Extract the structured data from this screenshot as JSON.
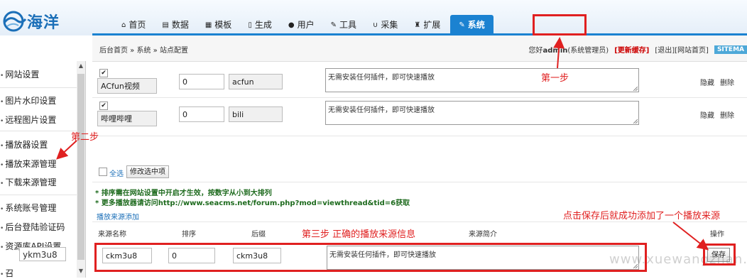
{
  "logo": {
    "text": "海洋"
  },
  "nav": [
    {
      "label": "首页",
      "icon": "home-icon",
      "glyph": "⌂"
    },
    {
      "label": "数据",
      "icon": "book-icon",
      "glyph": "▤"
    },
    {
      "label": "模板",
      "icon": "template-icon",
      "glyph": "▦"
    },
    {
      "label": "生成",
      "icon": "file-icon",
      "glyph": "▯"
    },
    {
      "label": "用户",
      "icon": "user-icon",
      "glyph": "●"
    },
    {
      "label": "工具",
      "icon": "wrench-icon",
      "glyph": "✎"
    },
    {
      "label": "采集",
      "icon": "magnet-icon",
      "glyph": "∪"
    },
    {
      "label": "扩展",
      "icon": "puzzle-icon",
      "glyph": "♜"
    },
    {
      "label": "系统",
      "icon": "edit-icon",
      "glyph": "✎"
    }
  ],
  "crumb": "后台首页 » 系统 » 站点配置",
  "user": {
    "greeting": "您好",
    "name": "admin",
    "role": "(系统管理员)",
    "refresh": "[更新缓存]",
    "logout": "[退出]",
    "home": "[网站首页]",
    "sitemap": "SITEMA"
  },
  "sidebar": [
    "网站设置",
    "图片水印设置",
    "远程图片设置",
    "播放器设置",
    "播放来源管理",
    "下载来源管理",
    "系统账号管理",
    "后台登陆验证码",
    "资源库API设置"
  ],
  "sidebar_input": "ykm3u8",
  "sidebar_last": "召",
  "rows": [
    {
      "name": "ACfun视频",
      "sort": "0",
      "suffix": "acfun",
      "desc": "无需安装任何插件，即可快速播放",
      "hide": "隐藏",
      "del": "删除",
      "checked": "✔"
    },
    {
      "name": "哔哩哔哩",
      "sort": "0",
      "suffix": "bili",
      "desc": "无需安装任何插件，即可快速播放",
      "hide": "隐藏",
      "del": "删除",
      "checked": "✔"
    }
  ],
  "toolbar": {
    "select_all": "全选",
    "modify": "修改选中项"
  },
  "notes": [
    "* 排序需在网站设置中开启才生效，按数字从小到大排列",
    "* 更多播放器请访问http://www.seacms.net/forum.php?mod=viewthread&tid=6获取"
  ],
  "add_section": {
    "title": "播放来源添加",
    "headers": {
      "name": "来源名称",
      "sort": "排序",
      "suffix": "后缀",
      "desc": "来源简介",
      "op": "操作"
    },
    "name": "ckm3u8",
    "sort": "0",
    "suffix": "ckm3u8",
    "desc": "无需安装任何插件，即可快速播放",
    "save": "保存"
  },
  "annotations": {
    "step1": "第一步",
    "step2": "第二步",
    "step3": "第三步 正确的播放来源信息",
    "save_note": "点击保存后就成功添加了一个播放来源"
  },
  "watermark": "www.xuewangzhan.net",
  "colors": {
    "accent": "#1b82d1",
    "annotation": "#e02020",
    "note_green": "#1d6a1d"
  }
}
